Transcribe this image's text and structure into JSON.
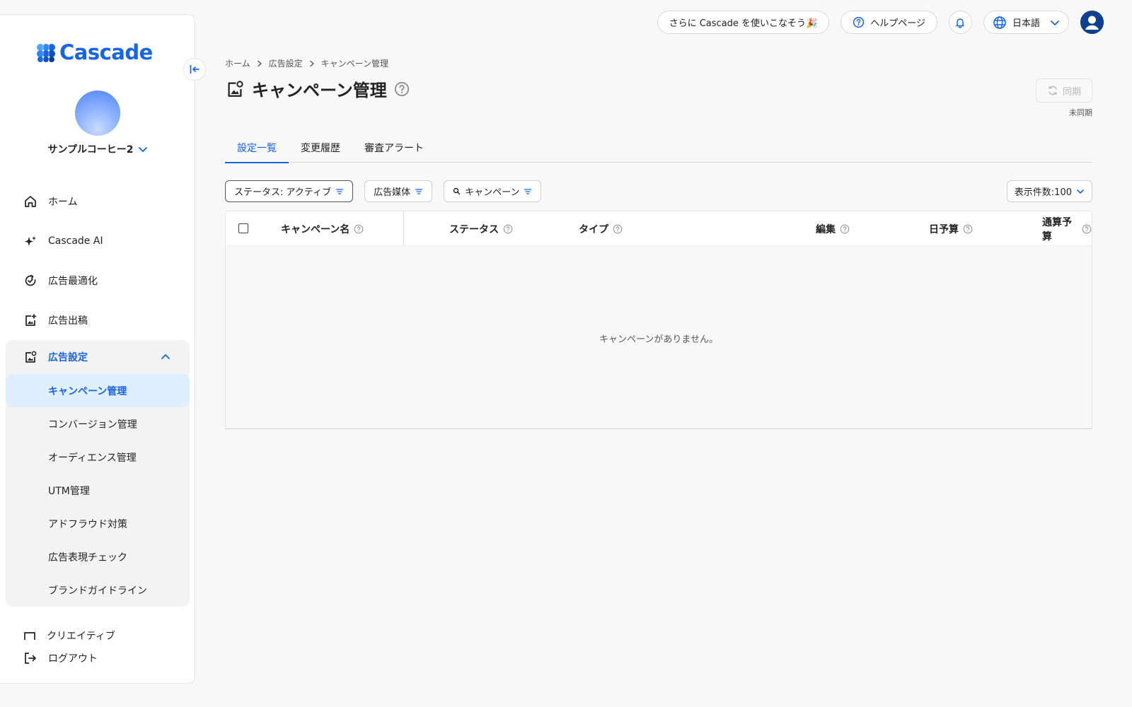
{
  "app": {
    "brand": "Cascade",
    "accent": "#1764e6"
  },
  "topbar": {
    "promo_label": "さらに Cascade を使いこなそう🎉",
    "help_label": "ヘルプページ",
    "language_label": "日本語"
  },
  "sidebar": {
    "account_name": "サンプルコーヒー2",
    "items": [
      {
        "label": "ホーム",
        "icon": "home-icon"
      },
      {
        "label": "Cascade AI",
        "icon": "sparkle-icon"
      },
      {
        "label": "広告最適化",
        "icon": "optimize-icon"
      },
      {
        "label": "広告出稿",
        "icon": "ad-post-icon"
      }
    ],
    "group": {
      "label": "広告設定",
      "icon": "ad-settings-icon",
      "expanded": true,
      "items": [
        {
          "label": "キャンペーン管理",
          "active": true
        },
        {
          "label": "コンバージョン管理",
          "active": false
        },
        {
          "label": "オーディエンス管理",
          "active": false
        },
        {
          "label": "UTM管理",
          "active": false
        },
        {
          "label": "アドフラウド対策",
          "active": false
        },
        {
          "label": "広告表現チェック",
          "active": false
        },
        {
          "label": "ブランドガイドライン",
          "active": false
        }
      ]
    },
    "partial_item": "クリエイティブ",
    "logout_label": "ログアウト"
  },
  "breadcrumb": [
    "ホーム",
    "広告設定",
    "キャンペーン管理"
  ],
  "page": {
    "title": "キャンペーン管理",
    "sync_label": "同期",
    "sync_status": "未同期"
  },
  "tabs": [
    {
      "label": "設定一覧",
      "active": true
    },
    {
      "label": "変更履歴",
      "active": false
    },
    {
      "label": "審査アラート",
      "active": false
    }
  ],
  "filters": {
    "status": "ステータス: アクティブ",
    "media": "広告媒体",
    "campaign": "キャンペーン",
    "per_page": "表示件数:100"
  },
  "table": {
    "columns": [
      "キャンペーン名",
      "ステータス",
      "タイプ",
      "編集",
      "日予算",
      "通算予算"
    ],
    "rows": [],
    "empty_message": "キャンペーンがありません。"
  }
}
